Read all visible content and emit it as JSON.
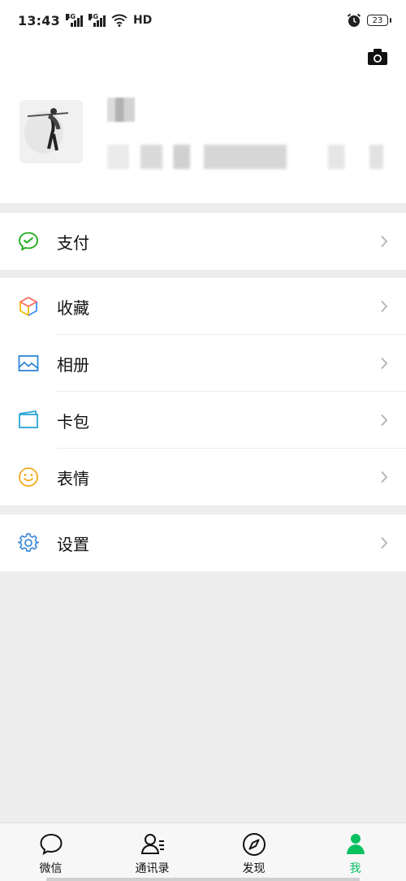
{
  "status_bar": {
    "time": "13:43",
    "network_1": "4G",
    "network_2": "4G",
    "hd": "HD",
    "battery": "23",
    "icons": [
      "signal-icon",
      "wifi-icon",
      "alarm-icon",
      "battery-icon"
    ]
  },
  "profile": {
    "camera_icon": "camera-icon"
  },
  "menu": {
    "pay": {
      "label": "支付",
      "icon": "wechat-pay-icon"
    },
    "favorites": {
      "label": "收藏",
      "icon": "cube-icon"
    },
    "album": {
      "label": "相册",
      "icon": "image-icon"
    },
    "cards": {
      "label": "卡包",
      "icon": "card-wallet-icon"
    },
    "stickers": {
      "label": "表情",
      "icon": "smiley-icon"
    },
    "settings": {
      "label": "设置",
      "icon": "gear-icon"
    }
  },
  "tabbar": {
    "chats": "微信",
    "contacts": "通讯录",
    "discover": "发现",
    "me": "我"
  },
  "colors": {
    "accent": "#07c160",
    "background": "#ededed",
    "pay_green": "#1aad19"
  }
}
